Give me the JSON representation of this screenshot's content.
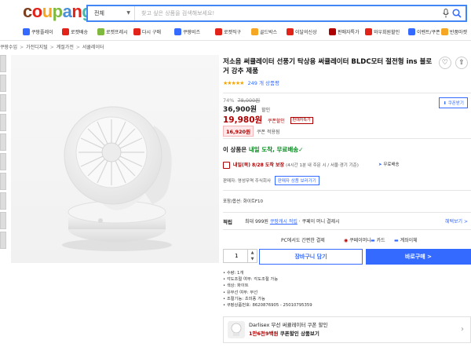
{
  "header": {
    "logo_letters": [
      {
        "ch": "c",
        "color": "#7b3f1f"
      },
      {
        "ch": "o",
        "color": "#e2231a"
      },
      {
        "ch": "u",
        "color": "#f5a623"
      },
      {
        "ch": "p",
        "color": "#80b93f"
      },
      {
        "ch": "a",
        "color": "#4a90d9"
      },
      {
        "ch": "n",
        "color": "#e2231a"
      },
      {
        "ch": "g",
        "color": "#4ab8a6"
      }
    ],
    "search_category": "전체",
    "search_placeholder": "찾고 싶은 상품을 검색해보세요!"
  },
  "category_nav": [
    {
      "label": "쿠팡플레이",
      "color": "#346aff"
    },
    {
      "label": "로켓배송",
      "color": "#e2231a"
    },
    {
      "label": "로켓프레시",
      "color": "#80b93f"
    },
    {
      "label": "다시 구매",
      "color": "#e2231a"
    },
    {
      "label": "쿠팡비즈",
      "color": "#346aff"
    },
    {
      "label": "로켓직구",
      "color": "#e2231a"
    },
    {
      "label": "골드박스",
      "color": "#f5a623"
    },
    {
      "label": "이달의신상",
      "color": "#e2231a"
    },
    {
      "label": "판매자특가",
      "color": "#ae0000"
    },
    {
      "label": "와우회원할인",
      "color": "#e2231a"
    },
    {
      "label": "이벤트/쿠폰",
      "color": "#346aff"
    },
    {
      "label": "반품마켓",
      "color": "#f5a623"
    }
  ],
  "breadcrumb": [
    "쿠팡수입",
    "가전디지털",
    "계절가전",
    "서큘레이터"
  ],
  "product": {
    "title": "저소음 써큘레이터 선풍기 탁상용 써큘레이터 BLDC모터 절전형 ins 블로거 강추 제품",
    "stars": "★★★★★",
    "review_count": "249 개 상품평",
    "discount": "74%",
    "orig_price": "78,000원",
    "sale_price": "36,900원",
    "sale_label": "할인",
    "coupon_price": "19,980원",
    "coupon_label": "쿠폰할인",
    "coupon_badge": "판매자특가",
    "card_price": "16,920원",
    "card_label": "쿠폰 적용됨",
    "coupon_down": "쿠폰받기",
    "arrival_prefix": "이 상품은",
    "arrival_highlight": "내일 도착, 무료배송",
    "delivery_date": "내일(목) 8/28 도착 보장",
    "delivery_note": "(4시간 1분 내 주문 시 / 서울⋅경기 기준)",
    "delivery_type": "무료배송",
    "seller_label": "판매자: 영성무역 주식회사",
    "seller_button": "판매자 상품 보러가기",
    "option": "포장/옵션: 화이트F10",
    "benefit_title": "적립",
    "benefit_text_1": "최대 999원",
    "benefit_text_2": "쿠팡캐시 적립",
    "benefit_text_3": "· 쿠페이 머니 결제시",
    "benefit_more": "혜택보기 >",
    "pay_label": "PC에서도 간편한 결제",
    "pay_opt_1": "쿠페이머니",
    "pay_opt_2": "카드",
    "pay_opt_3": "계좌이체",
    "quantity": "1",
    "cart_button": "장바구니 담기",
    "buy_button": "바로구매 >",
    "specs": [
      "수량: 1개",
      "각도조절 여부: 각도조절 가능",
      "색상: 화이트",
      "유무선 여부: 무선",
      "조절기능: 초미풍 가능",
      "쿠팡상품번호: 8620876905 - 25010795359"
    ],
    "promo_line_1": "Darlisex 무선 써큘레이터 쿠폰 할인",
    "promo_line_2_red": "1만6천9백원",
    "promo_line_2": "쿠폰할인 상품보기"
  },
  "colors": {
    "accent": "#346aff",
    "price_red": "#ae0000",
    "arrival_green": "#00891a"
  }
}
